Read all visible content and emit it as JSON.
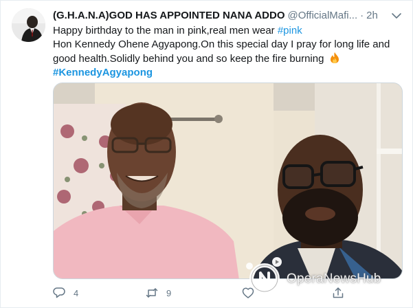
{
  "tweet": {
    "author_name": "(G.H.A.N.A)GOD HAS APPOINTED NANA ADDO",
    "handle": "@OfficialMafi...",
    "separator": "·",
    "time": "2h",
    "text": {
      "line1_plain": "Happy birthday to the man in pink,real men wear ",
      "line1_hashtag": "#pink",
      "body": "Hon Kennedy Ohene Agyapong.On this special day I pray for long life and good health.Solidly behind you and so keep the fire burning ",
      "fire_emoji_icon": "fire-emoji-icon",
      "final_hashtag": "#KennedyAgyapong"
    },
    "media": {
      "icon": "photo-two-men-selfie"
    },
    "actions": {
      "reply_count": "4",
      "retweet_count": "9",
      "like_count": "",
      "share_count": ""
    }
  },
  "watermark": {
    "text": "OperaNewsHub",
    "icon": "opera-news-hub-logo-icon"
  },
  "colors": {
    "accent": "#1b95e0",
    "secondary_text": "#657786",
    "border": "#e6ecf0"
  }
}
